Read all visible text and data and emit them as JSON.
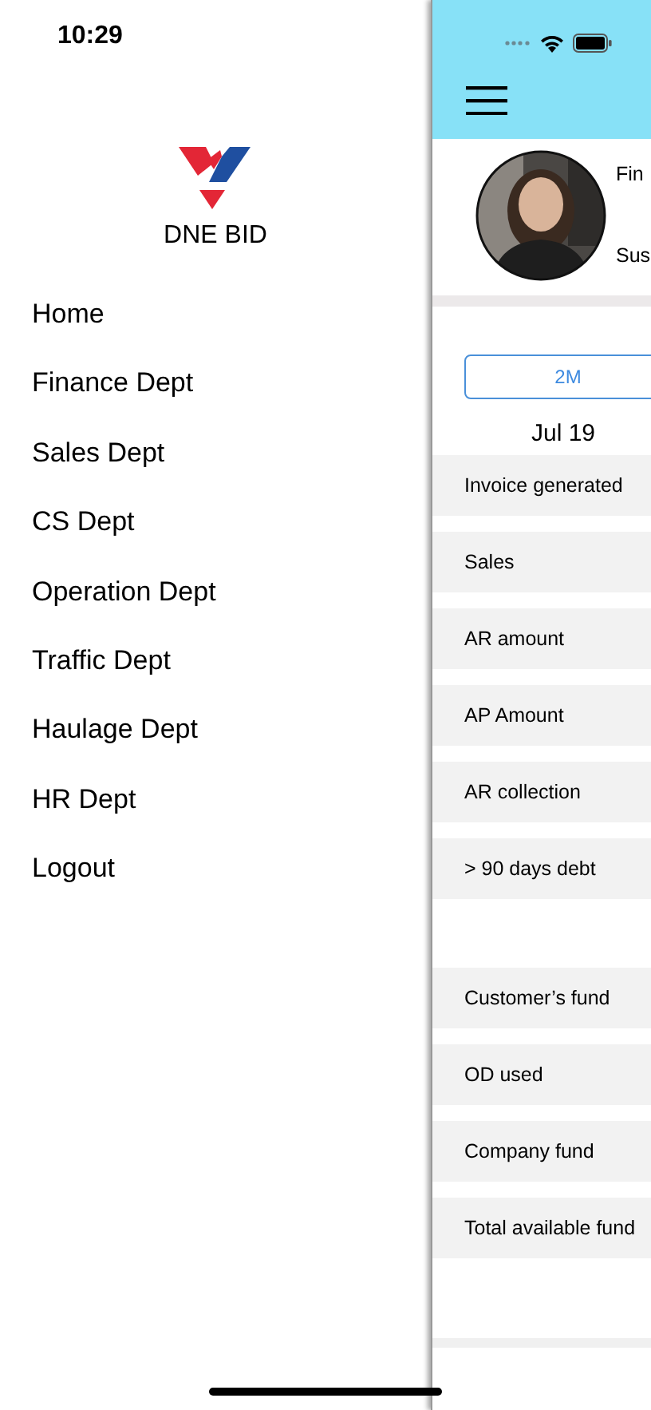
{
  "status_bar": {
    "time": "10:29"
  },
  "drawer": {
    "brand": "DNE BID",
    "items": [
      {
        "label": "Home"
      },
      {
        "label": "Finance Dept"
      },
      {
        "label": "Sales Dept"
      },
      {
        "label": "CS Dept"
      },
      {
        "label": "Operation Dept"
      },
      {
        "label": "Traffic Dept"
      },
      {
        "label": "Haulage Dept"
      },
      {
        "label": "HR Dept"
      },
      {
        "label": "Logout"
      }
    ]
  },
  "main": {
    "profile": {
      "line_1": "Fin",
      "line_2": "Sus"
    },
    "period_button": "2M",
    "date": "Jul 19",
    "groups": [
      {
        "rows": [
          {
            "label": "Invoice generated"
          },
          {
            "label": "Sales"
          },
          {
            "label": "AR amount"
          },
          {
            "label": "AP Amount"
          },
          {
            "label": "AR collection"
          },
          {
            "label": "> 90 days debt"
          }
        ]
      },
      {
        "rows": [
          {
            "label": "Customer’s fund"
          },
          {
            "label": "OD used"
          },
          {
            "label": "Company fund"
          },
          {
            "label": "Total available fund"
          }
        ]
      }
    ]
  }
}
